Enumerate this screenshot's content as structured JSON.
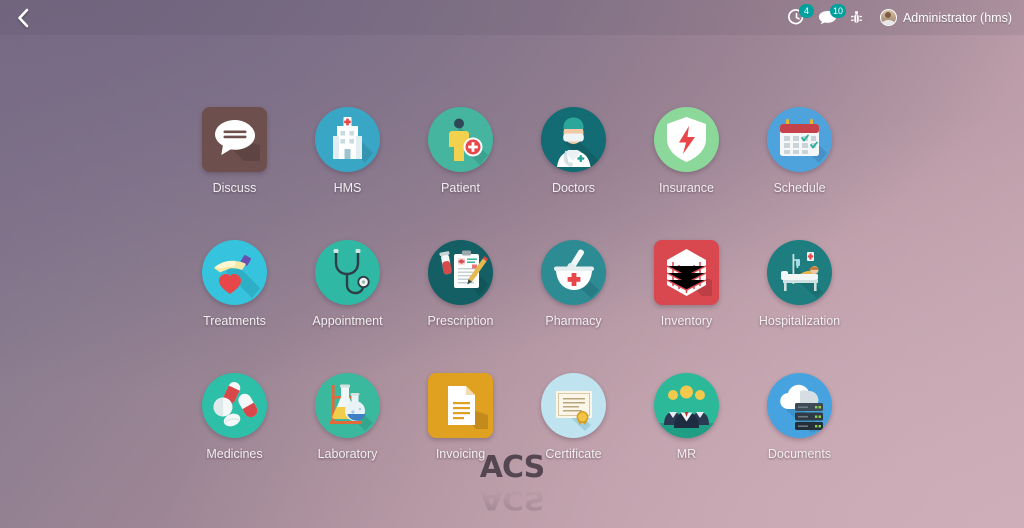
{
  "topbar": {
    "back_icon": "chevron-left-icon",
    "activity": {
      "icon": "activity-clock-icon",
      "badge": "4"
    },
    "messages": {
      "icon": "chat-bubble-icon",
      "badge": "10"
    },
    "debug": {
      "icon": "bug-icon"
    },
    "user": {
      "avatar": "user-avatar",
      "name": "Administrator (hms)"
    }
  },
  "apps": [
    {
      "label": "Discuss",
      "icon": "discuss-icon",
      "shape": "squircle",
      "bg": "#6d504d"
    },
    {
      "label": "HMS",
      "icon": "hospital-icon",
      "shape": "round",
      "bg": "#3aa6c6"
    },
    {
      "label": "Patient",
      "icon": "patient-icon",
      "shape": "round",
      "bg": "#45b5a0"
    },
    {
      "label": "Doctors",
      "icon": "doctor-icon",
      "shape": "round",
      "bg": "#136b73"
    },
    {
      "label": "Insurance",
      "icon": "shield-bolt-icon",
      "shape": "round",
      "bg": "#8bd89a"
    },
    {
      "label": "Schedule",
      "icon": "calendar-icon",
      "shape": "round",
      "bg": "#4ea3dd"
    },
    {
      "label": "Treatments",
      "icon": "hand-heart-icon",
      "shape": "round",
      "bg": "#35c3dd"
    },
    {
      "label": "Appointment",
      "icon": "stethoscope-icon",
      "shape": "round",
      "bg": "#2fb8a4"
    },
    {
      "label": "Prescription",
      "icon": "prescription-icon",
      "shape": "round",
      "bg": "#135f63"
    },
    {
      "label": "Pharmacy",
      "icon": "mortar-pestle-icon",
      "shape": "round",
      "bg": "#2c8b93"
    },
    {
      "label": "Inventory",
      "icon": "warehouse-icon",
      "shape": "squircle",
      "bg": "#d9474f"
    },
    {
      "label": "Hospitalization",
      "icon": "hospital-bed-icon",
      "shape": "round",
      "bg": "#1d7d7f"
    },
    {
      "label": "Medicines",
      "icon": "pills-icon",
      "shape": "round",
      "bg": "#2dbfa8"
    },
    {
      "label": "Laboratory",
      "icon": "lab-flask-icon",
      "shape": "round",
      "bg": "#3bb99f"
    },
    {
      "label": "Invoicing",
      "icon": "invoice-doc-icon",
      "shape": "squircle",
      "bg": "#e0a020"
    },
    {
      "label": "Certificate",
      "icon": "certificate-icon",
      "shape": "round",
      "bg": "#bfe4ef"
    },
    {
      "label": "MR",
      "icon": "people-group-icon",
      "shape": "round",
      "bg": "#2bb99a"
    },
    {
      "label": "Documents",
      "icon": "cloud-server-icon",
      "shape": "round",
      "bg": "#47a3e0"
    }
  ],
  "footer": {
    "logo_text": "ACS"
  },
  "colors": {
    "badge": "#00a09d",
    "label_text": "#f3eef1",
    "bg_start": "#7d7088",
    "bg_end": "#c9abb5"
  }
}
